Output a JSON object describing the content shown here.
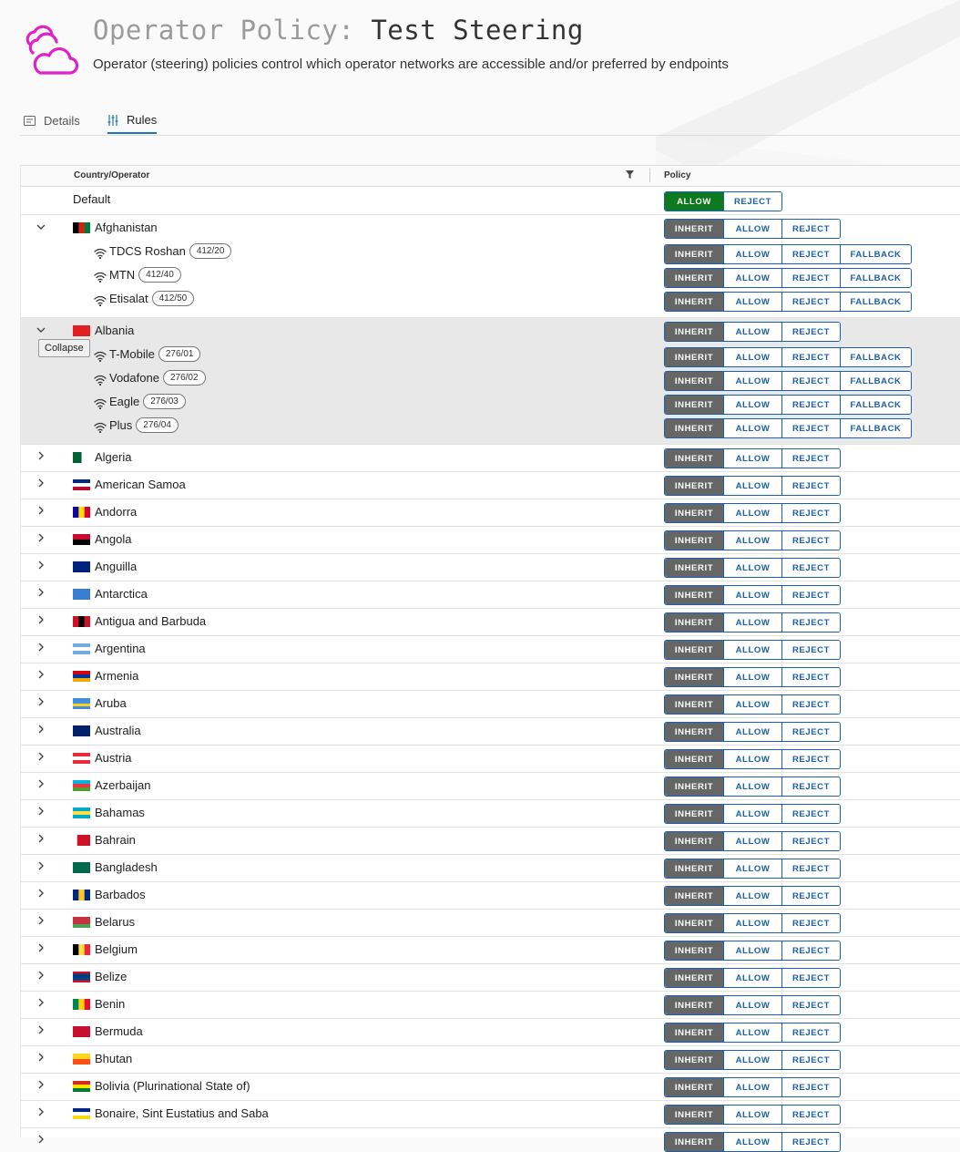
{
  "page": {
    "title_prefix": "Operator Policy:",
    "title_name": "Test Steering",
    "subtitle": "Operator (steering) policies control which operator networks are accessible and/or preferred by endpoints",
    "logo": "pink-clouds-logo"
  },
  "tabs": [
    {
      "label": "Details",
      "icon": "details-icon",
      "active": false
    },
    {
      "label": "Rules",
      "icon": "sliders-icon",
      "active": true
    }
  ],
  "table": {
    "col_country": "Country/Operator",
    "col_policy": "Policy",
    "filter_icon": "filter-icon"
  },
  "labels": {
    "inherit": "INHERIT",
    "allow": "ALLOW",
    "reject": "REJECT",
    "fallback": "FALLBACK"
  },
  "tooltip": "Collapse",
  "default_row": {
    "label": "Default",
    "selected": "allow",
    "options": [
      "allow",
      "reject"
    ]
  },
  "countries": [
    {
      "name": "Afghanistan",
      "expanded": true,
      "selected": "inherit",
      "flag": [
        "#000000",
        "#d32011",
        "#007a36"
      ],
      "flag_dir": "v",
      "operators": [
        {
          "name": "TDCS Roshan",
          "code": "412/20",
          "selected": "inherit"
        },
        {
          "name": "MTN",
          "code": "412/40",
          "selected": "inherit"
        },
        {
          "name": "Etisalat",
          "code": "412/50",
          "selected": "inherit"
        }
      ]
    },
    {
      "name": "Albania",
      "expanded": true,
      "highlight": true,
      "selected": "inherit",
      "flag": [
        "#e41e20"
      ],
      "flag_dir": "h",
      "operators": [
        {
          "name": "T-Mobile",
          "code": "276/01",
          "selected": "inherit"
        },
        {
          "name": "Vodafone",
          "code": "276/02",
          "selected": "inherit"
        },
        {
          "name": "Eagle",
          "code": "276/03",
          "selected": "inherit"
        },
        {
          "name": "Plus",
          "code": "276/04",
          "selected": "inherit"
        }
      ]
    },
    {
      "name": "Algeria",
      "selected": "inherit",
      "flag": [
        "#006233",
        "#ffffff"
      ],
      "flag_dir": "v"
    },
    {
      "name": "American Samoa",
      "selected": "inherit",
      "flag": [
        "#002b7f",
        "#ffffff",
        "#bf0a30"
      ],
      "flag_dir": "h"
    },
    {
      "name": "Andorra",
      "selected": "inherit",
      "flag": [
        "#10069f",
        "#fedd00",
        "#d50032"
      ],
      "flag_dir": "v"
    },
    {
      "name": "Angola",
      "selected": "inherit",
      "flag": [
        "#cc092f",
        "#000000"
      ],
      "flag_dir": "h"
    },
    {
      "name": "Anguilla",
      "selected": "inherit",
      "flag": [
        "#00247d"
      ],
      "flag_dir": "h"
    },
    {
      "name": "Antarctica",
      "selected": "inherit",
      "flag": [
        "#3a7dce"
      ],
      "flag_dir": "h"
    },
    {
      "name": "Antigua and Barbuda",
      "selected": "inherit",
      "flag": [
        "#ce1126",
        "#000000",
        "#ce1126"
      ],
      "flag_dir": "v"
    },
    {
      "name": "Argentina",
      "selected": "inherit",
      "flag": [
        "#74acdf",
        "#ffffff",
        "#74acdf"
      ],
      "flag_dir": "h"
    },
    {
      "name": "Armenia",
      "selected": "inherit",
      "flag": [
        "#d90012",
        "#0033a0",
        "#f2a800"
      ],
      "flag_dir": "h"
    },
    {
      "name": "Aruba",
      "selected": "inherit",
      "flag": [
        "#418fde",
        "#418fde",
        "#fcd116",
        "#418fde"
      ],
      "flag_dir": "h"
    },
    {
      "name": "Australia",
      "selected": "inherit",
      "flag": [
        "#012169"
      ],
      "flag_dir": "h"
    },
    {
      "name": "Austria",
      "selected": "inherit",
      "flag": [
        "#ed2939",
        "#ffffff",
        "#ed2939"
      ],
      "flag_dir": "h"
    },
    {
      "name": "Azerbaijan",
      "selected": "inherit",
      "flag": [
        "#00b5e2",
        "#ef3340",
        "#509e2f"
      ],
      "flag_dir": "h"
    },
    {
      "name": "Bahamas",
      "selected": "inherit",
      "flag": [
        "#00abc9",
        "#fae042",
        "#00abc9"
      ],
      "flag_dir": "h"
    },
    {
      "name": "Bahrain",
      "selected": "inherit",
      "flag": [
        "#ffffff",
        "#ce1126",
        "#ce1126",
        "#ce1126"
      ],
      "flag_dir": "v"
    },
    {
      "name": "Bangladesh",
      "selected": "inherit",
      "flag": [
        "#006a4e"
      ],
      "flag_dir": "h"
    },
    {
      "name": "Barbados",
      "selected": "inherit",
      "flag": [
        "#00267f",
        "#ffc726",
        "#00267f"
      ],
      "flag_dir": "v"
    },
    {
      "name": "Belarus",
      "selected": "inherit",
      "flag": [
        "#c8313e",
        "#c8313e",
        "#4aa657"
      ],
      "flag_dir": "h"
    },
    {
      "name": "Belgium",
      "selected": "inherit",
      "flag": [
        "#000000",
        "#fae042",
        "#ed2939"
      ],
      "flag_dir": "v"
    },
    {
      "name": "Belize",
      "selected": "inherit",
      "flag": [
        "#ce1126",
        "#003f87",
        "#003f87",
        "#003f87",
        "#ce1126"
      ],
      "flag_dir": "h"
    },
    {
      "name": "Benin",
      "selected": "inherit",
      "flag": [
        "#008751",
        "#fcd116",
        "#e8112d"
      ],
      "flag_dir": "v"
    },
    {
      "name": "Bermuda",
      "selected": "inherit",
      "flag": [
        "#c8102e"
      ],
      "flag_dir": "h"
    },
    {
      "name": "Bhutan",
      "selected": "inherit",
      "flag": [
        "#ffd520",
        "#ff4e12"
      ],
      "flag_dir": "h"
    },
    {
      "name": "Bolivia (Plurinational State of)",
      "selected": "inherit",
      "flag": [
        "#d52b1e",
        "#f9e300",
        "#007934"
      ],
      "flag_dir": "h"
    },
    {
      "name": "Bonaire, Sint Eustatius and Saba",
      "selected": "inherit",
      "flag": [
        "#012a87",
        "#ffffff",
        "#f9d90f"
      ],
      "flag_dir": "h"
    },
    {
      "name": "",
      "selected": "inherit",
      "flag": [],
      "flag_dir": "h"
    }
  ]
}
